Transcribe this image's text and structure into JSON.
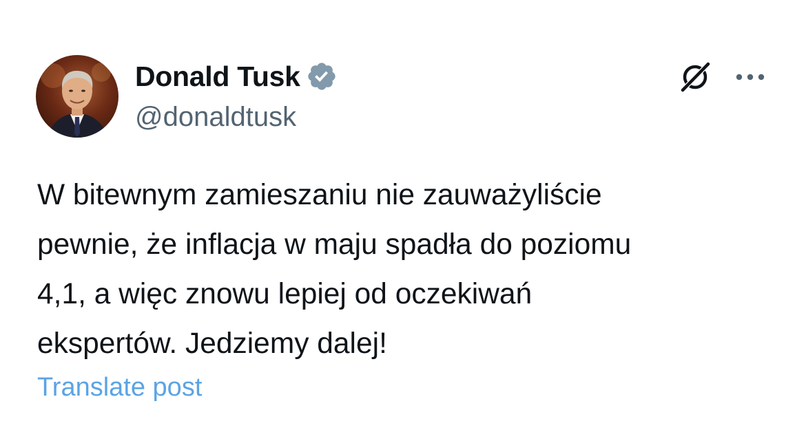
{
  "tweet": {
    "author": {
      "display_name": "Donald Tusk",
      "handle": "@donaldtusk",
      "verified_icon": "verified-badge-icon",
      "avatar": "profile-photo"
    },
    "text": "W bitewnym zamieszaniu nie zauważyliście\npewnie, że inflacja w maju spadła do poziomu\n4,1, a więc znowu lepiej od oczekiwań\nekspertów. Jedziemy dalej!",
    "translate_label": "Translate post",
    "actions": {
      "grok_icon": "grok-icon",
      "more_icon": "more-options-icon"
    }
  },
  "colors": {
    "text": "#0f1419",
    "secondary_text": "#536471",
    "link": "#5ba4e4",
    "verified_badge": "#829aab",
    "background": "#ffffff"
  }
}
